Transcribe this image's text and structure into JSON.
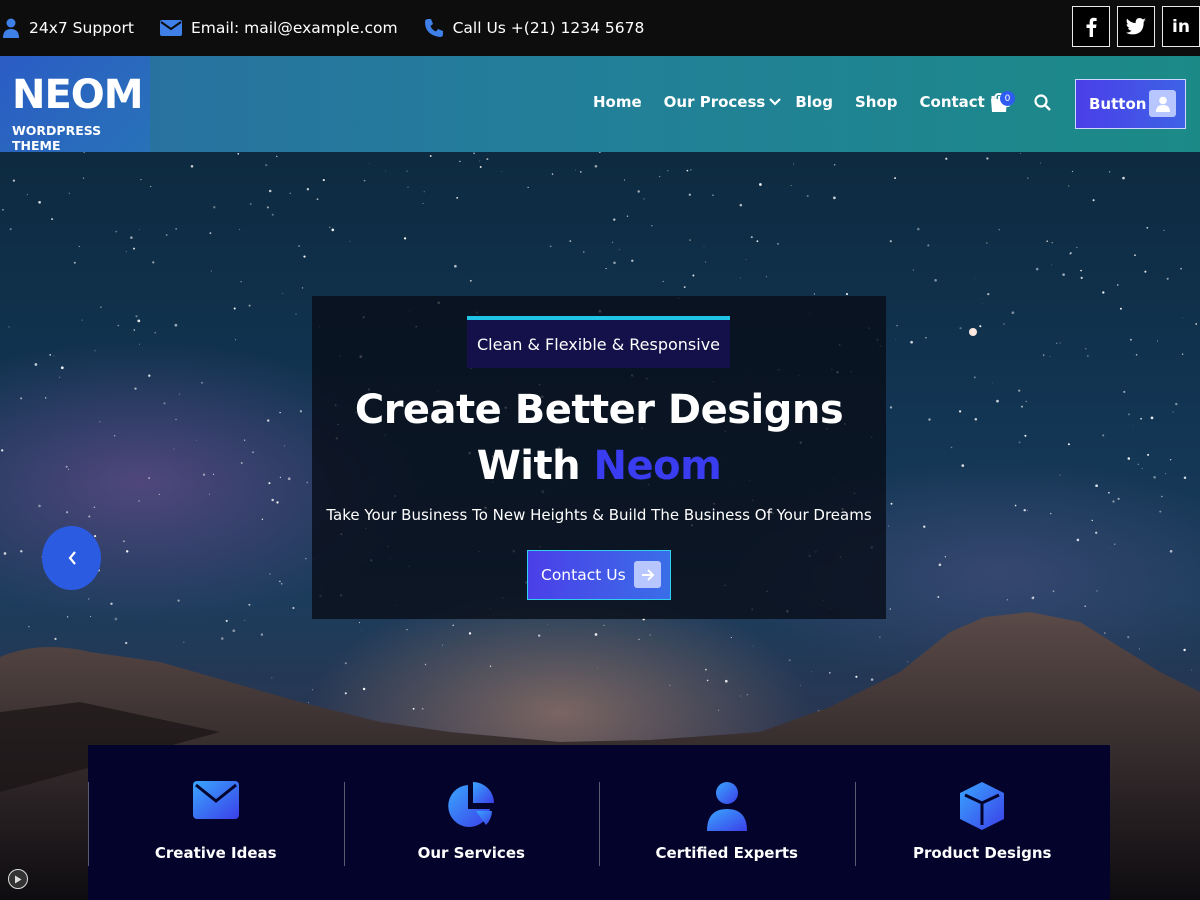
{
  "topbar": {
    "support": "24x7 Support",
    "email": "Email: mail@example.com",
    "phone": "Call Us +(21) 1234 5678",
    "socials": [
      "facebook-icon",
      "twitter-icon",
      "linkedin-icon"
    ],
    "social_labels": [
      "f",
      "t",
      "in"
    ]
  },
  "header": {
    "brand_title": "NEOM",
    "brand_subtitle": "WORDPRESS THEME",
    "nav": [
      "Home",
      "Our Process",
      "Blog",
      "Shop",
      "Contact Us"
    ],
    "cart_count": "0",
    "button_label": "Button"
  },
  "hero": {
    "tagline": "Clean & Flexible & Responsive",
    "headline_line1": "Create Better Designs",
    "headline_line2_prefix": "With ",
    "headline_accent": "Neom",
    "subline": "Take Your Business To New Heights & Build The Business Of Your Dreams",
    "cta_label": "Contact Us"
  },
  "features": [
    {
      "label": "Creative Ideas",
      "icon": "envelope-icon"
    },
    {
      "label": "Our Services",
      "icon": "pie-chart-icon"
    },
    {
      "label": "Certified Experts",
      "icon": "user-icon"
    },
    {
      "label": "Product Designs",
      "icon": "cube-icon"
    }
  ],
  "colors": {
    "accent": "#3a3cf0",
    "brand_blue": "#2b5be0",
    "cyan": "#1fc4e6",
    "feature_bg": "#04032b"
  }
}
